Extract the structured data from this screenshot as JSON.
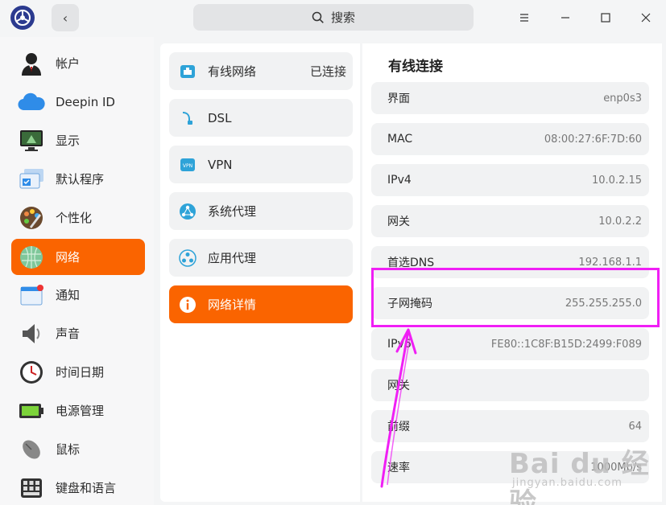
{
  "header": {
    "search_label": "搜索"
  },
  "sidebar": {
    "items": [
      {
        "label": "帐户",
        "icon": "user-avatar-icon"
      },
      {
        "label": "Deepin ID",
        "icon": "cloud-icon"
      },
      {
        "label": "显示",
        "icon": "monitor-icon"
      },
      {
        "label": "默认程序",
        "icon": "default-apps-icon"
      },
      {
        "label": "个性化",
        "icon": "palette-icon"
      },
      {
        "label": "网络",
        "icon": "globe-network-icon"
      },
      {
        "label": "通知",
        "icon": "notification-icon"
      },
      {
        "label": "声音",
        "icon": "speaker-icon"
      },
      {
        "label": "时间日期",
        "icon": "clock-icon"
      },
      {
        "label": "电源管理",
        "icon": "battery-icon"
      },
      {
        "label": "鼠标",
        "icon": "mouse-icon"
      },
      {
        "label": "键盘和语言",
        "icon": "keyboard-icon"
      }
    ],
    "active_index": 5
  },
  "network_menu": {
    "items": [
      {
        "label": "有线网络",
        "status": "已连接",
        "icon": "wired-network-icon"
      },
      {
        "label": "DSL",
        "status": "",
        "icon": "dsl-icon"
      },
      {
        "label": "VPN",
        "status": "",
        "icon": "vpn-icon"
      },
      {
        "label": "系统代理",
        "status": "",
        "icon": "system-proxy-icon"
      },
      {
        "label": "应用代理",
        "status": "",
        "icon": "app-proxy-icon"
      },
      {
        "label": "网络详情",
        "status": "",
        "icon": "info-icon"
      }
    ],
    "active_index": 5
  },
  "detail": {
    "title": "有线连接",
    "rows": [
      {
        "label": "界面",
        "value": "enp0s3"
      },
      {
        "label": "MAC",
        "value": "08:00:27:6F:7D:60"
      },
      {
        "label": "IPv4",
        "value": "10.0.2.15"
      },
      {
        "label": "网关",
        "value": "10.0.2.2"
      },
      {
        "label": "首选DNS",
        "value": "192.168.1.1"
      },
      {
        "label": "子网掩码",
        "value": "255.255.255.0"
      },
      {
        "label": "IPv6",
        "value": "FE80::1C8F:B15D:2499:F089"
      },
      {
        "label": "网关",
        "value": ""
      },
      {
        "label": "前缀",
        "value": "64"
      },
      {
        "label": "速率",
        "value": "1000Mb/s"
      }
    ]
  },
  "watermark": {
    "main": "Bai du 经验",
    "sub": "jingyan.baidu.com"
  },
  "colors": {
    "accent": "#fa6400",
    "annotation": "#f01ff5"
  }
}
